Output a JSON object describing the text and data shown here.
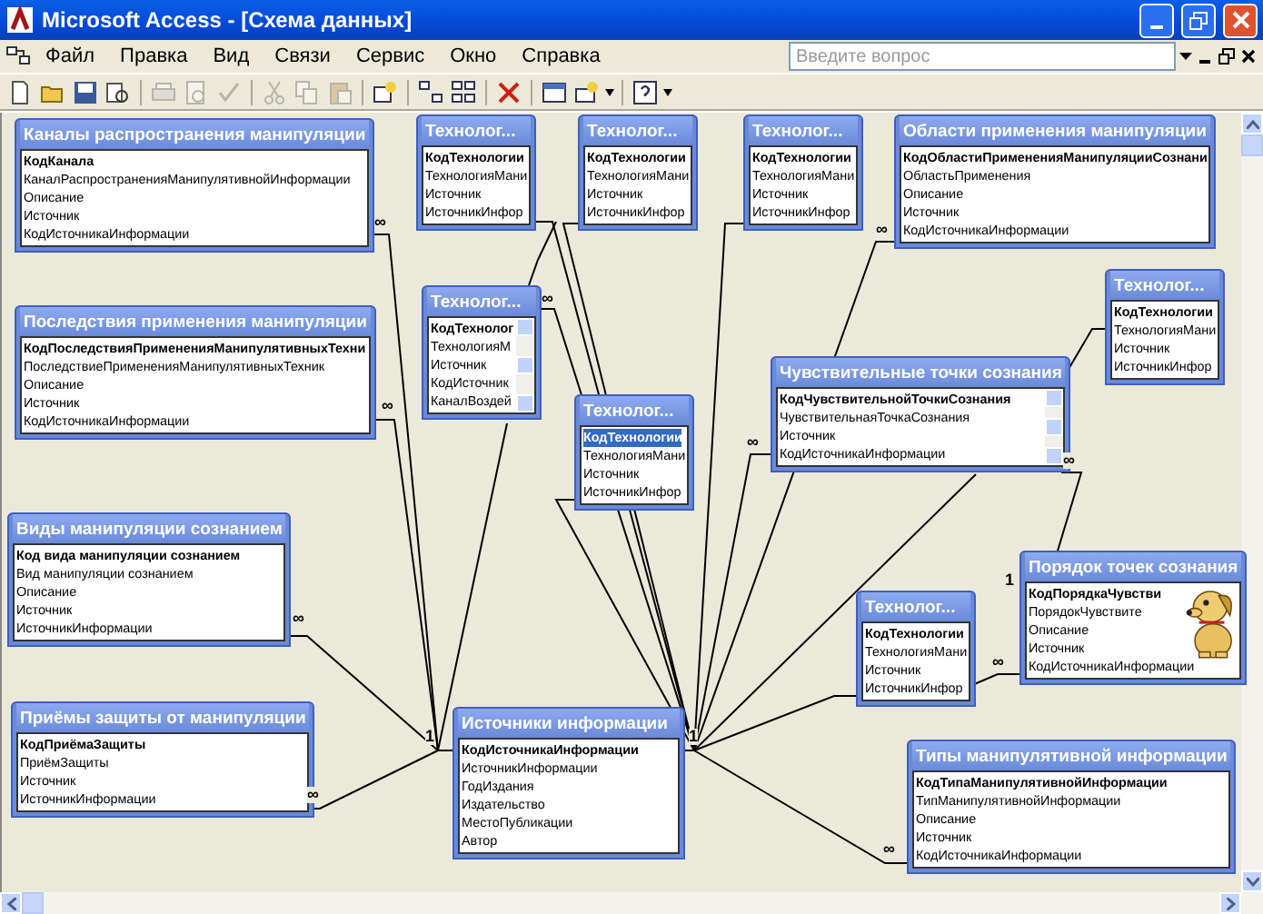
{
  "window": {
    "title": "Microsoft Access - [Схема данных]"
  },
  "menu": [
    "Файл",
    "Правка",
    "Вид",
    "Связи",
    "Сервис",
    "Окно",
    "Справка"
  ],
  "help_search": {
    "placeholder": "Введите вопрос"
  },
  "tables": [
    {
      "title": "Каналы распространения манипуляции",
      "key_field": "КодКанала",
      "key_selected": false,
      "fields": [
        "КаналРаспространенияМанипулятивнойИнформации",
        "Описание",
        "Источник",
        "КодИсточникаИнформации"
      ],
      "marks": [
        "∞"
      ]
    },
    {
      "title": "Технолог...",
      "key_field": "КодТехнологии",
      "key_selected": false,
      "fields": [
        "ТехнологияМани",
        "Источник",
        "ИсточникИнфор"
      ]
    },
    {
      "title": "Технолог...",
      "key_field": "КодТехнологии",
      "key_selected": false,
      "fields": [
        "ТехнологияМани",
        "Источник",
        "ИсточникИнфор"
      ]
    },
    {
      "title": "Технолог...",
      "key_field": "КодТехнологии",
      "key_selected": false,
      "fields": [
        "ТехнологияМани",
        "Источник",
        "ИсточникИнфор"
      ]
    },
    {
      "title": "Области применения манипуляции",
      "key_field": "КодОбластиПримененияМанипуляцииСознани",
      "key_selected": false,
      "fields": [
        "ОбластьПрименения",
        "Описание",
        "Источник",
        "КодИсточникаИнформации"
      ],
      "marks": [
        "∞"
      ]
    },
    {
      "title": "Последствия применения манипуляции",
      "key_field": "КодПоследствияПримененияМанипулятивныхТехни",
      "key_selected": false,
      "fields": [
        "ПоследствиеПримененияМанипулятивныхТехник",
        "Описание",
        "Источник",
        "КодИсточникаИнформации"
      ],
      "marks": [
        "∞"
      ]
    },
    {
      "title": "Технолог...",
      "key_field": "КодТехнолог",
      "key_selected": false,
      "fields": [
        "ТехнологияМ",
        "Источник",
        "КодИсточник",
        "КаналВоздей"
      ],
      "scrollbar": true,
      "marks": [
        "∞"
      ]
    },
    {
      "title": "Технолог...",
      "key_field": "КодТехнологии",
      "key_selected": false,
      "fields": [
        "ТехнологияМани",
        "Источник",
        "ИсточникИнфор"
      ]
    },
    {
      "title": "Чувствительные точки сознания",
      "key_field": "КодЧувствительнойТочкиСознания",
      "key_selected": false,
      "fields": [
        "ЧувствительнаяТочкаСознания",
        "Источник",
        "КодИсточникаИнформации"
      ],
      "scrollbar": true,
      "marks": [
        "∞",
        "∞"
      ]
    },
    {
      "title": "Технолог...",
      "key_field": "КодТехнологии",
      "key_selected": true,
      "fields": [
        "ТехнологияМани",
        "Источник",
        "ИсточникИнфор"
      ]
    },
    {
      "title": "Виды манипуляции сознанием",
      "key_field": "Код вида манипуляции сознанием",
      "key_selected": false,
      "fields": [
        "Вид манипуляции сознанием",
        "Описание",
        "Источник",
        "ИсточникИнформации"
      ],
      "marks": [
        "∞"
      ]
    },
    {
      "title": "Порядок точек сознания",
      "key_field": "КодПорядкаЧувстви",
      "key_selected": false,
      "fields": [
        "ПорядокЧувствите",
        "Описание",
        "Источник",
        "КодИсточникаИнформации"
      ],
      "marks": [
        "1",
        "∞"
      ]
    },
    {
      "title": "Технолог...",
      "key_field": "КодТехнологии",
      "key_selected": false,
      "fields": [
        "ТехнологияМани",
        "Источник",
        "ИсточникИнфор"
      ]
    },
    {
      "title": "Приёмы защиты от манипуляции",
      "key_field": "КодПриёмаЗащиты",
      "key_selected": false,
      "fields": [
        "ПриёмЗащиты",
        "Источник",
        "ИсточникИнформации"
      ],
      "marks": [
        "∞"
      ]
    },
    {
      "title": "Источники информации",
      "key_field": "КодИсточникаИнформации",
      "key_selected": false,
      "fields": [
        "ИсточникИнформации",
        "ГодИздания",
        "Издательство",
        "МестоПубликации",
        "Автор"
      ],
      "marks": [
        "1",
        "1"
      ]
    },
    {
      "title": "Типы манипулятивной информации",
      "key_field": "КодТипаМанипулятивнойИнформации",
      "key_selected": false,
      "fields": [
        "ТипМанипулятивнойИнформации",
        "Описание",
        "Источник",
        "КодИсточникаИнформации"
      ],
      "marks": [
        "∞"
      ]
    }
  ]
}
